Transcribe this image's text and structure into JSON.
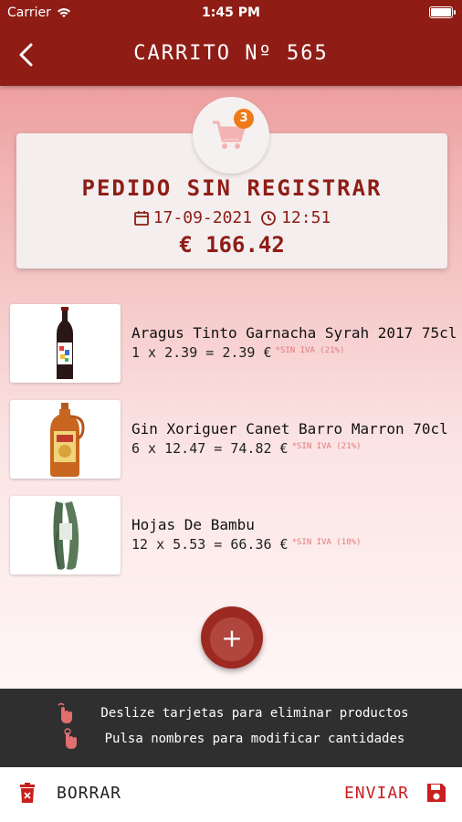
{
  "status_bar": {
    "carrier": "Carrier",
    "time": "1:45 PM"
  },
  "navbar": {
    "title": "CARRITO Nº 565",
    "back_icon": "chevron-left-icon"
  },
  "cart": {
    "badge_count": "3",
    "icon": "shopping-cart-icon"
  },
  "order": {
    "status": "PEDIDO SIN REGISTRAR",
    "date": "17-09-2021",
    "time": "12:51",
    "total": "€ 166.42"
  },
  "products": [
    {
      "name": "Aragus Tinto Garnacha Syrah 2017 75cl",
      "qty_line": "1 x 2.39 = 2.39 €",
      "tax": "*SIN IVA (21%)",
      "image": "wine-bottle"
    },
    {
      "name": "Gin Xoriguer Canet Barro Marron 70cl",
      "qty_line": "6 x 12.47 = 74.82 €",
      "tax": "*SIN IVA (21%)",
      "image": "gin-jug"
    },
    {
      "name": "Hojas De Bambu",
      "qty_line": "12 x 5.53 = 66.36 €",
      "tax": "*SIN IVA (10%)",
      "image": "bamboo-leaves"
    }
  ],
  "add_button": "+",
  "hints": [
    {
      "icon": "swipe-gesture-icon",
      "text": "Deslize tarjetas para eliminar productos"
    },
    {
      "icon": "tap-gesture-icon",
      "text": "Pulsa nombres para modificar cantidades"
    }
  ],
  "bottom_bar": {
    "delete_label": "BORRAR",
    "send_label": "ENVIAR"
  },
  "colors": {
    "primary": "#8f1d16",
    "accent": "#c91f1f",
    "badge": "#f07a1a",
    "hint_bg": "#2f2f2f"
  }
}
